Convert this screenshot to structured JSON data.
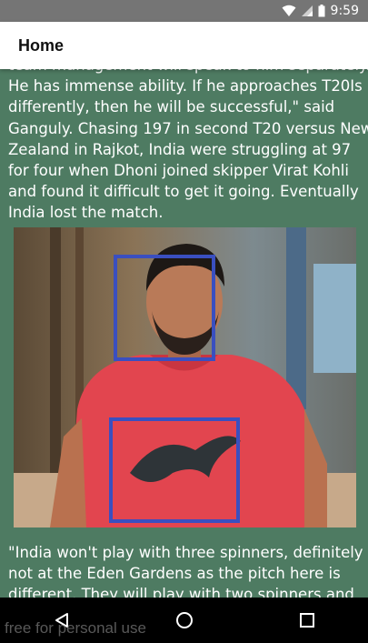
{
  "status_bar": {
    "time": "9:59"
  },
  "app_bar": {
    "title": "Home"
  },
  "article": {
    "paragraph_1": "team management will speak to him separately. He has immense ability. If he approaches T20Is differently, then he will be successful,\" said Ganguly. Chasing 197 in second T20 versus New Zealand in Rajkot, India were struggling at 97 for four when Dhoni joined skipper Virat Kohli and found it difficult to get it going. Eventually India lost the match.",
    "paragraph_2": "\"India won't play with three spinners, definitely not at the Eden Gardens as the pitch here is different. They will play with two spinners and now"
  },
  "photo": {
    "detection_boxes": [
      "face",
      "logo"
    ],
    "box_color": "#3a4fc0"
  },
  "nav_bar": {
    "buttons": [
      "back",
      "home",
      "recents"
    ]
  },
  "watermark": "free for personal use",
  "colors": {
    "background": "#4e7b62",
    "status_bar": "#757575",
    "app_bar": "#ffffff"
  }
}
